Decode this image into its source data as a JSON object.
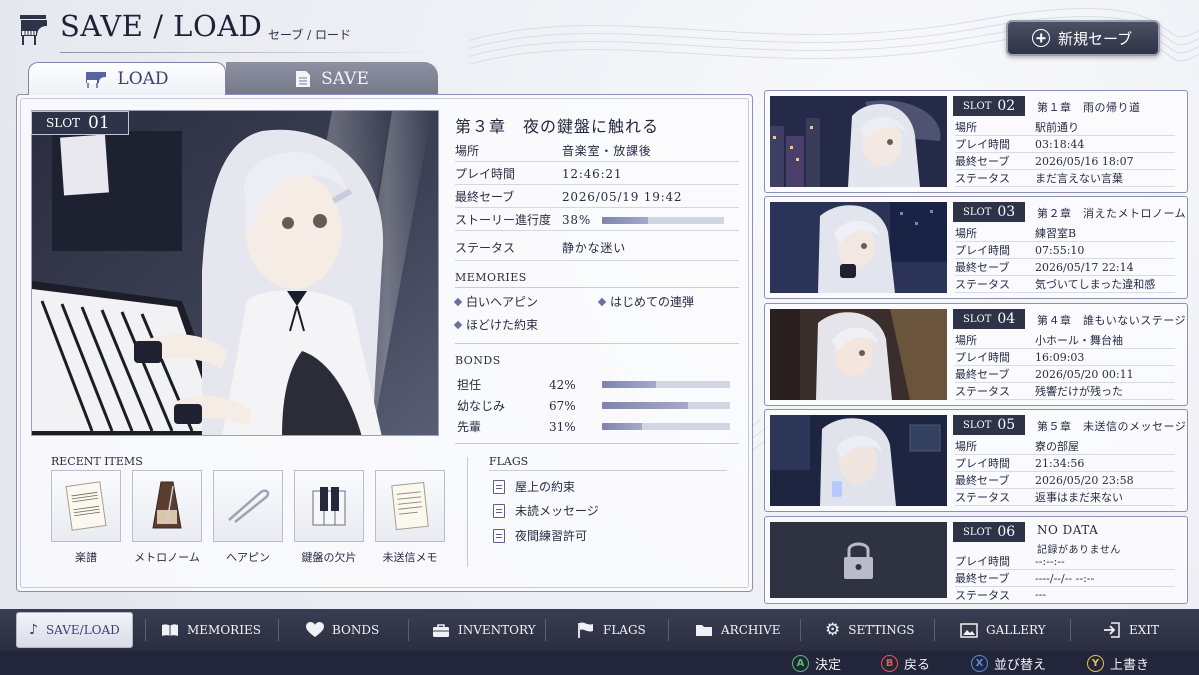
{
  "header": {
    "title": "SAVE / LOAD",
    "subtitle": "セーブ / ロード",
    "new_save_label": "新規セーブ"
  },
  "tabs": {
    "load": "LOAD",
    "save": "SAVE"
  },
  "selected_slot": {
    "slot_label": "SLOT",
    "slot_number": "01",
    "chapter": "第３章　夜の鍵盤に触れる",
    "fields": [
      {
        "key": "場所",
        "value": "音楽室・放課後"
      },
      {
        "key": "プレイ時間",
        "value": "12:46:21"
      },
      {
        "key": "最終セーブ",
        "value": "2026/05/19 19:42"
      },
      {
        "key": "ストーリー進行度",
        "value": "38%"
      },
      {
        "key": "ステータス",
        "value": "静かな迷い"
      }
    ],
    "progress": 0.38,
    "memories_label": "MEMORIES",
    "memories": [
      "白いヘアピン",
      "はじめての連弾",
      "ほどけた約束"
    ],
    "bonds_label": "BONDS",
    "bonds": [
      {
        "name": "担任",
        "value": "42%",
        "level": 0.42
      },
      {
        "name": "幼なじみ",
        "value": "67%",
        "level": 0.67
      },
      {
        "name": "先輩",
        "value": "31%",
        "level": 0.31
      }
    ],
    "recent_items_label": "RECENT ITEMS",
    "recent_items": [
      {
        "name": "楽譜",
        "icon": "sheet-music-icon"
      },
      {
        "name": "メトロノーム",
        "icon": "metronome-icon"
      },
      {
        "name": "ヘアピン",
        "icon": "hairpin-icon"
      },
      {
        "name": "鍵盤の欠片",
        "icon": "key-fragment-icon"
      },
      {
        "name": "未送信メモ",
        "icon": "memo-icon"
      }
    ],
    "flags_label": "FLAGS",
    "flags": [
      "屋上の約束",
      "未読メッセージ",
      "夜間練習許可"
    ]
  },
  "slots": [
    {
      "slot_label": "SLOT",
      "number": "02",
      "title": "第１章　雨の帰り道",
      "fields": [
        {
          "key": "場所",
          "value": "駅前通り"
        },
        {
          "key": "プレイ時間",
          "value": "03:18:44"
        },
        {
          "key": "最終セーブ",
          "value": "2026/05/16 18:07"
        },
        {
          "key": "ステータス",
          "value": "まだ言えない言葉"
        }
      ]
    },
    {
      "slot_label": "SLOT",
      "number": "03",
      "title": "第２章　消えたメトロノーム",
      "fields": [
        {
          "key": "場所",
          "value": "練習室B"
        },
        {
          "key": "プレイ時間",
          "value": "07:55:10"
        },
        {
          "key": "最終セーブ",
          "value": "2026/05/17 22:14"
        },
        {
          "key": "ステータス",
          "value": "気づいてしまった違和感"
        }
      ]
    },
    {
      "slot_label": "SLOT",
      "number": "04",
      "title": "第４章　誰もいないステージ",
      "fields": [
        {
          "key": "場所",
          "value": "小ホール・舞台袖"
        },
        {
          "key": "プレイ時間",
          "value": "16:09:03"
        },
        {
          "key": "最終セーブ",
          "value": "2026/05/20 00:11"
        },
        {
          "key": "ステータス",
          "value": "残響だけが残った"
        }
      ]
    },
    {
      "slot_label": "SLOT",
      "number": "05",
      "title": "第５章　未送信のメッセージ",
      "fields": [
        {
          "key": "場所",
          "value": "寮の部屋"
        },
        {
          "key": "プレイ時間",
          "value": "21:34:56"
        },
        {
          "key": "最終セーブ",
          "value": "2026/05/20 23:58"
        },
        {
          "key": "ステータス",
          "value": "返事はまだ来ない"
        }
      ]
    },
    {
      "slot_label": "SLOT",
      "number": "06",
      "title": "NO DATA",
      "subtitle": "記録がありません",
      "fields": [
        {
          "key": "プレイ時間",
          "value": "--:--:--"
        },
        {
          "key": "最終セーブ",
          "value": "----/--/-- --:--"
        },
        {
          "key": "ステータス",
          "value": "---"
        }
      ]
    }
  ],
  "nav": [
    {
      "label": "SAVE/LOAD",
      "icon": "note-icon",
      "active": true
    },
    {
      "label": "MEMORIES",
      "icon": "book-icon"
    },
    {
      "label": "BONDS",
      "icon": "heart-icon"
    },
    {
      "label": "INVENTORY",
      "icon": "bag-icon"
    },
    {
      "label": "FLAGS",
      "icon": "flag-icon"
    },
    {
      "label": "ARCHIVE",
      "icon": "folder-icon"
    },
    {
      "label": "SETTINGS",
      "icon": "gear-icon"
    },
    {
      "label": "GALLERY",
      "icon": "image-icon"
    },
    {
      "label": "EXIT",
      "icon": "exit-icon"
    }
  ],
  "controls": [
    {
      "button": "A",
      "label": "決定",
      "color": "#4fbf6a"
    },
    {
      "button": "B",
      "label": "戻る",
      "color": "#e05a5a"
    },
    {
      "button": "X",
      "label": "並び替え",
      "color": "#4f8ee0"
    },
    {
      "button": "Y",
      "label": "上書き",
      "color": "#e8c23a"
    }
  ],
  "colors": {
    "accent": "#2e3348",
    "progress": "#8a90b8",
    "panel_border": "#8a91b3"
  }
}
